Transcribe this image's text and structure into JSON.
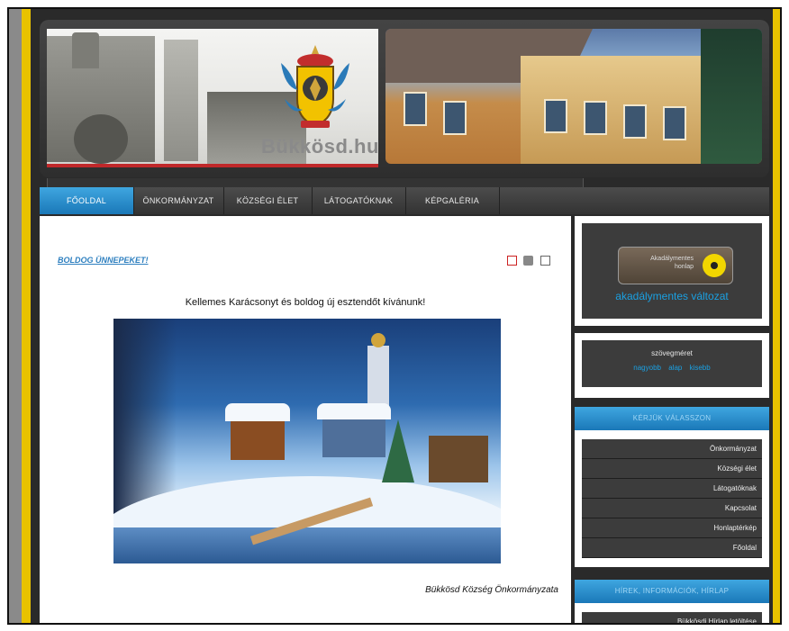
{
  "header": {
    "site_name": "Bükkösd.hu"
  },
  "nav": {
    "items": [
      {
        "label": "FŐOLDAL",
        "active": true
      },
      {
        "label": "ÖNKORMÁNYZAT",
        "active": false
      },
      {
        "label": "KÖZSÉGI ÉLET",
        "active": false
      },
      {
        "label": "LÁTOGATÓKNAK",
        "active": false
      },
      {
        "label": "KÉPGALÉRIA",
        "active": false
      }
    ]
  },
  "article": {
    "title": "BOLDOG ÜNNEPEKET!",
    "greeting": "Kellemes Karácsonyt és boldog új esztendőt kívánunk!",
    "signature": "Bükkösd Község Önkormányzata",
    "icons": [
      "pdf-icon",
      "print-icon",
      "email-icon"
    ]
  },
  "sidebar": {
    "accessible": {
      "badge_text": "Akadálymentes honlap",
      "link": "akadálymentes változat"
    },
    "textsize": {
      "label": "szövegméret",
      "options": [
        "nagyobb",
        "alap",
        "kisebb"
      ]
    },
    "menu_section": {
      "title": "KÉRJÜK VÁLASSZON",
      "items": [
        "Önkormányzat",
        "Községi élet",
        "Látogatóknak",
        "Kapcsolat",
        "Honlaptérkép",
        "Főoldal"
      ]
    },
    "news_section": {
      "title": "HÍREK, INFORMÁCIÓK, HÍRLAP",
      "items": [
        "Bükkösdi Hírlap letöltése"
      ]
    }
  },
  "colors": {
    "accent_blue": "#1aa0e2",
    "frame_yellow": "#e8c200",
    "dark_bg": "#2a2a2a"
  }
}
